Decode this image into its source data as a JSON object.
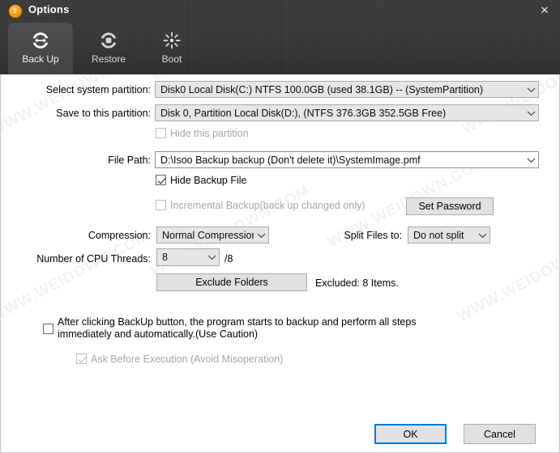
{
  "window": {
    "title": "Options",
    "app_icon": "app-logo-icon",
    "close_label": "✕"
  },
  "tabs": [
    {
      "id": "backup",
      "label": "Back Up",
      "icon": "backup-icon",
      "active": true
    },
    {
      "id": "restore",
      "label": "Restore",
      "icon": "restore-icon",
      "active": false
    },
    {
      "id": "boot",
      "label": "Boot",
      "icon": "boot-icon",
      "active": false
    }
  ],
  "form": {
    "select_system_partition": {
      "label": "Select system partition:",
      "value": "Disk0  Local Disk(C:) NTFS 100.0GB (used 38.1GB) -- (SystemPartition)"
    },
    "save_to_partition": {
      "label": "Save to this partition:",
      "value": "Disk 0, Partition Local Disk(D:), (NTFS 376.3GB 352.5GB Free)"
    },
    "hide_this_partition": {
      "label": "Hide this partition",
      "checked": false,
      "enabled": false
    },
    "file_path": {
      "label": "File Path:",
      "value": "D:\\Isoo Backup backup (Don't delete it)\\SystemImage.pmf"
    },
    "hide_backup_file": {
      "label": "Hide Backup File",
      "checked": true,
      "enabled": true
    },
    "incremental_backup": {
      "label": "Incremental Backup(back up changed only)",
      "checked": false,
      "enabled": false
    },
    "set_password_button": "Set Password",
    "compression": {
      "label": "Compression:",
      "value": "Normal Compression"
    },
    "split_files": {
      "label": "Split Files to:",
      "value": "Do not split"
    },
    "cpu_threads": {
      "label": "Number of CPU Threads:",
      "value": "8",
      "suffix": "/8"
    },
    "exclude_folders_button": "Exclude Folders",
    "excluded_status": "Excluded: 8 Items.",
    "auto_backup": {
      "label": "After clicking BackUp button, the program starts to backup and perform all steps immediately and automatically.(Use Caution)",
      "checked": false,
      "enabled": true
    },
    "ask_before_execution": {
      "label": "Ask Before Execution (Avoid Misoperation)",
      "checked": true,
      "enabled": false
    }
  },
  "footer": {
    "ok_label": "OK",
    "cancel_label": "Cancel"
  },
  "watermark": {
    "text": "WWW.WEIDOWN.COM"
  },
  "colors": {
    "accent": "#0078d7",
    "header_dark": "#3a3a3a",
    "brand_orange": "#f5a01b"
  }
}
